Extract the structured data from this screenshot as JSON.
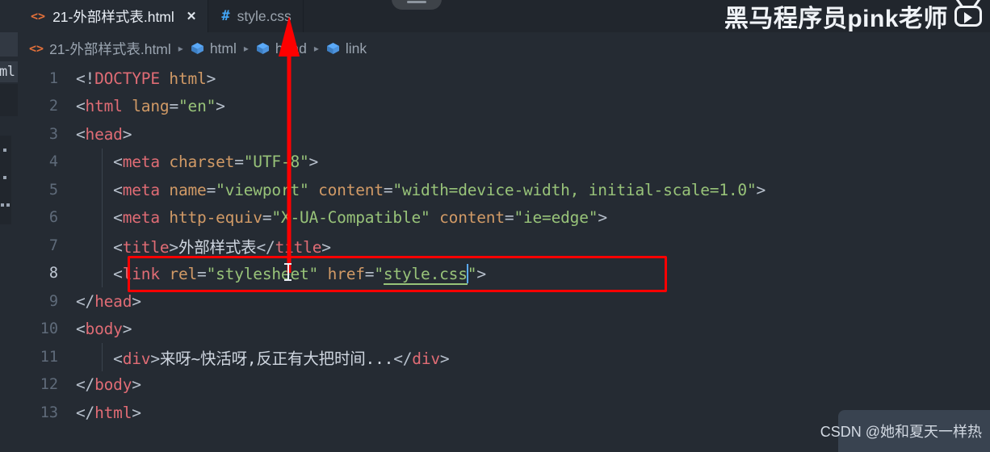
{
  "window": {
    "editor_bg": "#252b33",
    "chrome_bg": "#21262d",
    "accent_red": "#fe0000"
  },
  "tabs": [
    {
      "label": "21-外部样式表.html",
      "icon": "html-file-icon",
      "icon_glyph": "<>",
      "active": true,
      "closable": true,
      "close_glyph": "✕"
    },
    {
      "label": "style.css",
      "icon": "css-file-icon",
      "icon_glyph": "#",
      "active": false,
      "closable": false,
      "close_glyph": ""
    }
  ],
  "breadcrumb": {
    "items": [
      {
        "label": "21-外部样式表.html",
        "icon": "html-file-icon"
      },
      {
        "label": "html",
        "icon": "symbol-cube-icon"
      },
      {
        "label": "head",
        "icon": "symbol-cube-icon"
      },
      {
        "label": "link",
        "icon": "symbol-cube-icon"
      }
    ],
    "separator": "▸"
  },
  "explorer": {
    "file_fragment": "ml"
  },
  "editor": {
    "active_line": 8,
    "lines": [
      {
        "n": "1",
        "indent": 0,
        "tokens": [
          {
            "t": "punc",
            "v": "<!"
          },
          {
            "t": "tag",
            "v": "DOCTYPE"
          },
          {
            "t": "txt",
            "v": " "
          },
          {
            "t": "attr",
            "v": "html"
          },
          {
            "t": "punc",
            "v": ">"
          }
        ]
      },
      {
        "n": "2",
        "indent": 0,
        "tokens": [
          {
            "t": "punc",
            "v": "<"
          },
          {
            "t": "tag",
            "v": "html"
          },
          {
            "t": "txt",
            "v": " "
          },
          {
            "t": "attr",
            "v": "lang"
          },
          {
            "t": "punc",
            "v": "="
          },
          {
            "t": "str",
            "v": "\"en\""
          },
          {
            "t": "punc",
            "v": ">"
          }
        ]
      },
      {
        "n": "3",
        "indent": 0,
        "tokens": [
          {
            "t": "punc",
            "v": "<"
          },
          {
            "t": "tag",
            "v": "head"
          },
          {
            "t": "punc",
            "v": ">"
          }
        ]
      },
      {
        "n": "4",
        "indent": 1,
        "tokens": [
          {
            "t": "punc",
            "v": "    <"
          },
          {
            "t": "tag",
            "v": "meta"
          },
          {
            "t": "txt",
            "v": " "
          },
          {
            "t": "attr",
            "v": "charset"
          },
          {
            "t": "punc",
            "v": "="
          },
          {
            "t": "str",
            "v": "\"UTF-8\""
          },
          {
            "t": "punc",
            "v": ">"
          }
        ]
      },
      {
        "n": "5",
        "indent": 1,
        "tokens": [
          {
            "t": "punc",
            "v": "    <"
          },
          {
            "t": "tag",
            "v": "meta"
          },
          {
            "t": "txt",
            "v": " "
          },
          {
            "t": "attr",
            "v": "name"
          },
          {
            "t": "punc",
            "v": "="
          },
          {
            "t": "str",
            "v": "\"viewport\""
          },
          {
            "t": "txt",
            "v": " "
          },
          {
            "t": "attr",
            "v": "content"
          },
          {
            "t": "punc",
            "v": "="
          },
          {
            "t": "str",
            "v": "\"width=device-width, initial-scale=1.0\""
          },
          {
            "t": "punc",
            "v": ">"
          }
        ]
      },
      {
        "n": "6",
        "indent": 1,
        "tokens": [
          {
            "t": "punc",
            "v": "    <"
          },
          {
            "t": "tag",
            "v": "meta"
          },
          {
            "t": "txt",
            "v": " "
          },
          {
            "t": "attr",
            "v": "http-equiv"
          },
          {
            "t": "punc",
            "v": "="
          },
          {
            "t": "str",
            "v": "\"X-UA-Compatible\""
          },
          {
            "t": "txt",
            "v": " "
          },
          {
            "t": "attr",
            "v": "content"
          },
          {
            "t": "punc",
            "v": "="
          },
          {
            "t": "str",
            "v": "\"ie=edge\""
          },
          {
            "t": "punc",
            "v": ">"
          }
        ]
      },
      {
        "n": "7",
        "indent": 1,
        "tokens": [
          {
            "t": "punc",
            "v": "    <"
          },
          {
            "t": "tag",
            "v": "title"
          },
          {
            "t": "punc",
            "v": ">"
          },
          {
            "t": "txt",
            "v": "外部样式表"
          },
          {
            "t": "punc",
            "v": "</"
          },
          {
            "t": "tag",
            "v": "title"
          },
          {
            "t": "punc",
            "v": ">"
          }
        ]
      },
      {
        "n": "8",
        "indent": 1,
        "active": true,
        "tokens": [
          {
            "t": "punc",
            "v": "    <"
          },
          {
            "t": "tag",
            "v": "link"
          },
          {
            "t": "txt",
            "v": " "
          },
          {
            "t": "attr",
            "v": "rel"
          },
          {
            "t": "punc",
            "v": "="
          },
          {
            "t": "str",
            "v": "\"stylesheet\""
          },
          {
            "t": "txt",
            "v": " "
          },
          {
            "t": "attr",
            "v": "href"
          },
          {
            "t": "punc",
            "v": "="
          },
          {
            "t": "str",
            "v": "\""
          },
          {
            "t": "link",
            "v": "style.css"
          },
          {
            "t": "caret",
            "v": ""
          },
          {
            "t": "str",
            "v": "\""
          },
          {
            "t": "punc",
            "v": ">"
          }
        ]
      },
      {
        "n": "9",
        "indent": 0,
        "tokens": [
          {
            "t": "punc",
            "v": "</"
          },
          {
            "t": "tag",
            "v": "head"
          },
          {
            "t": "punc",
            "v": ">"
          }
        ]
      },
      {
        "n": "10",
        "indent": 0,
        "tokens": [
          {
            "t": "punc",
            "v": "<"
          },
          {
            "t": "tag",
            "v": "body"
          },
          {
            "t": "punc",
            "v": ">"
          }
        ]
      },
      {
        "n": "11",
        "indent": 1,
        "tokens": [
          {
            "t": "punc",
            "v": "    <"
          },
          {
            "t": "tag",
            "v": "div"
          },
          {
            "t": "punc",
            "v": ">"
          },
          {
            "t": "txt",
            "v": "来呀~快活呀,反正有大把时间..."
          },
          {
            "t": "punc",
            "v": "</"
          },
          {
            "t": "tag",
            "v": "div"
          },
          {
            "t": "punc",
            "v": ">"
          }
        ]
      },
      {
        "n": "12",
        "indent": 0,
        "tokens": [
          {
            "t": "punc",
            "v": "</"
          },
          {
            "t": "tag",
            "v": "body"
          },
          {
            "t": "punc",
            "v": ">"
          }
        ]
      },
      {
        "n": "13",
        "indent": 0,
        "tokens": [
          {
            "t": "punc",
            "v": "</"
          },
          {
            "t": "tag",
            "v": "html"
          },
          {
            "t": "punc",
            "v": ">"
          }
        ]
      }
    ]
  },
  "annotations": {
    "highlight_box_line": 8,
    "arrow_from": "line 8 href value",
    "arrow_to": "style.css tab"
  },
  "watermarks": {
    "top_right": "黑马程序员pink老师",
    "top_right_logo": "bilibili-logo",
    "bottom_right": "CSDN @她和夏天一样热"
  }
}
